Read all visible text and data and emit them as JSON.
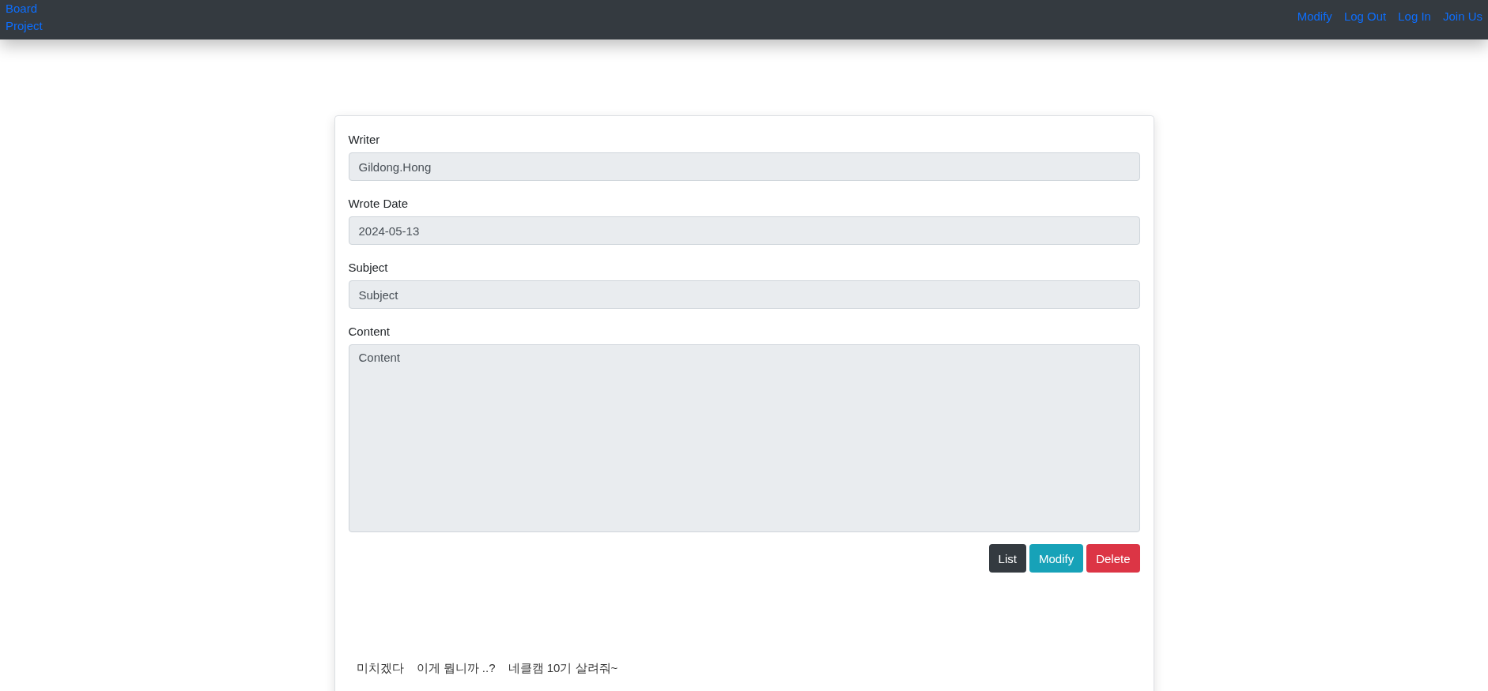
{
  "navbar": {
    "brand": "Board\nProject",
    "links": [
      "Modify",
      "Log Out",
      "Log In",
      "Join Us"
    ]
  },
  "form": {
    "fields": [
      {
        "label": "Writer",
        "kind": "input",
        "value": "Gildong.Hong"
      },
      {
        "label": "Wrote Date",
        "kind": "input",
        "value": "2024-05-13"
      },
      {
        "label": "Subject",
        "kind": "input",
        "value": "Subject"
      },
      {
        "label": "Content",
        "kind": "textarea",
        "value": "Content"
      }
    ],
    "buttons": [
      {
        "label": "List",
        "kind": "dark"
      },
      {
        "label": "Modify",
        "kind": "info"
      },
      {
        "label": "Delete",
        "kind": "danger"
      }
    ]
  },
  "comments": [
    "미치겠다",
    "이게 뭡니까 ..?",
    "네클캠 10기 살려줘~"
  ]
}
